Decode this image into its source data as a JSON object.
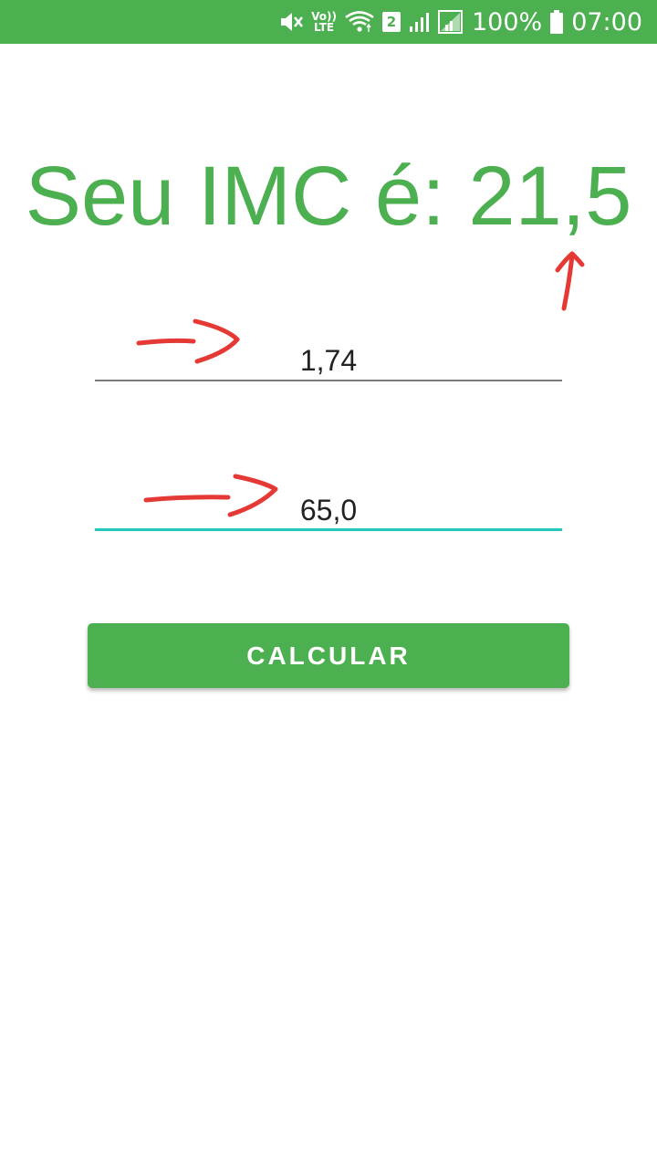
{
  "status_bar": {
    "volte_top": "Vo))",
    "volte_bottom": "LTE",
    "sim_badge": "2",
    "battery_percent": "100%",
    "time": "07:00",
    "icons": [
      "mute-icon",
      "volte-icon",
      "wifi-icon",
      "sim2-badge-icon",
      "signal-icon",
      "signal-icon",
      "battery-icon"
    ]
  },
  "main": {
    "result_text": "Seu IMC é: 21,5",
    "height_field": {
      "value": "1,74"
    },
    "weight_field": {
      "value": "65,0"
    },
    "calculate_button": {
      "label": "CALCULAR"
    }
  },
  "colors": {
    "primary": "#4caf50",
    "accent": "#26c6bd",
    "annotation": "#e53935"
  }
}
